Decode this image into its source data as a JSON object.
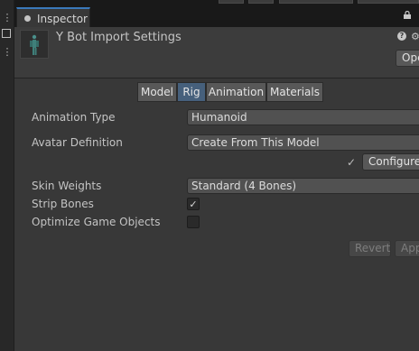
{
  "window": {
    "tab_label": "Inspector",
    "tab_icon": "info-icon",
    "lock_icon": "lock-icon"
  },
  "left_strip": {
    "icons": [
      "kebab-menu-icon",
      "panel-dock-icon",
      "kebab-menu-icon"
    ]
  },
  "header": {
    "title": "Y Bot Import Settings",
    "thumbnail_icon": "humanoid-model-icon",
    "help_icon": "help-icon",
    "settings_icon": "settings-icon",
    "open_button": "Open"
  },
  "toolbar": {
    "tabs": [
      {
        "label": "Model",
        "active": false
      },
      {
        "label": "Rig",
        "active": true
      },
      {
        "label": "Animation",
        "active": false
      },
      {
        "label": "Materials",
        "active": false
      }
    ]
  },
  "rig": {
    "animation_type": {
      "label": "Animation Type",
      "value": "Humanoid"
    },
    "avatar_definition": {
      "label": "Avatar Definition",
      "value": "Create From This Model"
    },
    "configure_button": "Configure...",
    "configured_check": "✓",
    "skin_weights": {
      "label": "Skin Weights",
      "value": "Standard (4 Bones)"
    },
    "strip_bones": {
      "label": "Strip Bones",
      "checked": true,
      "mark": "✓"
    },
    "optimize_game_objects": {
      "label": "Optimize Game Objects",
      "checked": false
    }
  },
  "footer": {
    "revert_button": "Revert",
    "apply_button": "Apply"
  },
  "colors": {
    "accent": "#3a79bb",
    "active_tab": "#46607c",
    "panel_bg": "#383838",
    "header_bg": "#3c3c3c"
  }
}
